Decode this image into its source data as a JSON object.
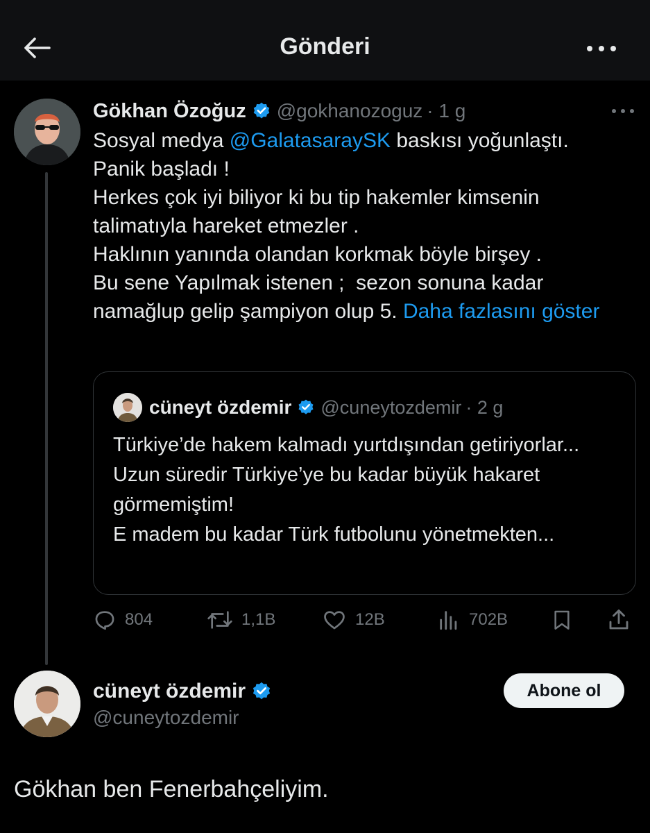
{
  "header": {
    "title": "Gönderi",
    "back_icon": "arrow-left-icon",
    "more_icon": "more-horizontal-icon"
  },
  "colors": {
    "background": "#000000",
    "header_bg": "#0f1012",
    "text": "#e7e9ea",
    "muted": "#71767b",
    "link": "#1d9bf0",
    "verified": "#1d9bf0"
  },
  "post": {
    "author_name": "Gökhan Özoğuz",
    "author_handle": "@gokhanozoguz",
    "time": "· 1 g",
    "text_1": "Sosyal medya ",
    "mention": "@GalatasaraySK",
    "text_2": " baskısı yoğunlaştı.\nPanik başladı !\nHerkes çok iyi biliyor ki bu tip hakemler kimsenin talimatıyla hareket etmezler .\nHaklının yanında olandan korkmak böyle birşey .\nBu sene Yapılmak istenen ;  sezon sonuna kadar namağlup gelip şampiyon olup 5. ",
    "show_more": "Daha fazlasını göster",
    "quote": {
      "author_name": "cüneyt özdemir",
      "author_handle": "@cuneytozdemir",
      "time": "· 2 g",
      "text": "Türkiye’de hakem kalmadı yurtdışından getiriyorlar...\nUzun süredir Türkiye’ye bu kadar büyük hakaret görmemiştim!\nE madem bu kadar Türk futbolunu yönetmekten..."
    },
    "actions": {
      "replies": "804",
      "reposts": "1,1B",
      "likes": "12B",
      "views": "702B"
    }
  },
  "reply": {
    "author_name": "cüneyt özdemir",
    "author_handle": "@cuneytozdemir",
    "follow_label": "Abone ol",
    "text": "Gökhan ben Fenerbahçeliyim."
  }
}
